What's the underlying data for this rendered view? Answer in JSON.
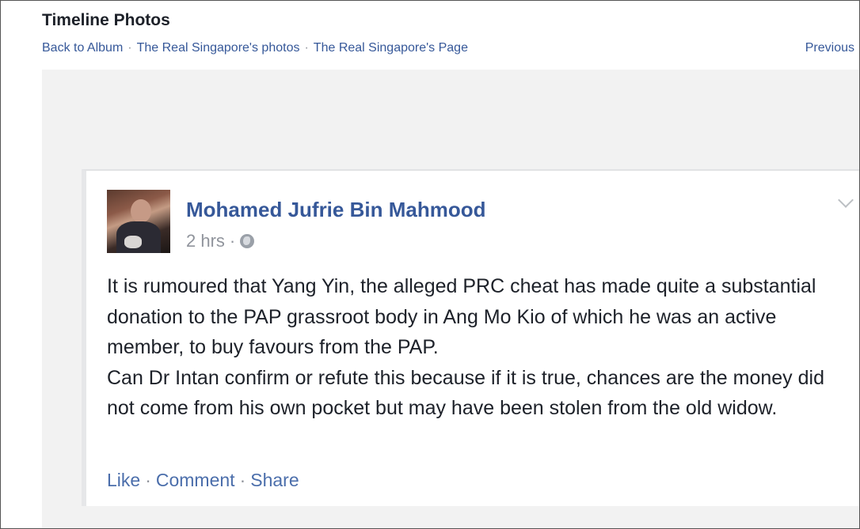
{
  "page": {
    "title": "Timeline Photos"
  },
  "breadcrumb": {
    "items": [
      "Back to Album",
      "The Real Singapore's photos",
      "The Real Singapore's Page"
    ],
    "separator": "·"
  },
  "nav": {
    "previous_label": "Previous"
  },
  "post": {
    "author": "Mohamed Jufrie Bin Mahmood",
    "time": "2 hrs",
    "meta_separator": "·",
    "privacy_icon": "globe-icon",
    "paragraphs": [
      "It is rumoured that Yang Yin, the alleged PRC cheat has made quite a substantial donation to the PAP grassroot body in Ang Mo Kio of which he was an active member, to buy favours from the PAP.",
      "Can Dr Intan confirm or refute this because if it is true, chances are the money did not come from his own pocket but may have been stolen from the old widow."
    ],
    "actions": [
      "Like",
      "Comment",
      "Share"
    ],
    "action_separator": "·"
  },
  "colors": {
    "link": "#365899",
    "text": "#1d2129",
    "muted": "#90949c",
    "stage_bg": "#f2f2f2"
  }
}
